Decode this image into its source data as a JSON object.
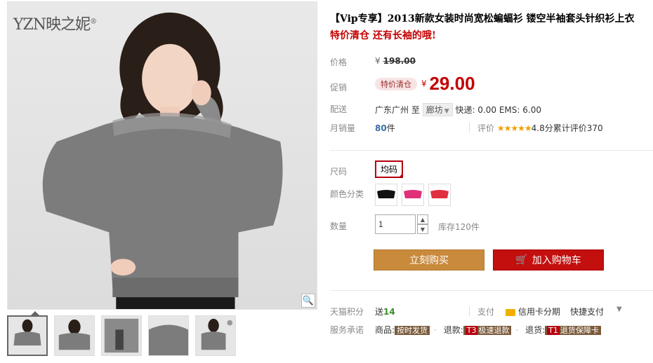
{
  "brand": {
    "logo_text": "YZN",
    "logo_cn": "映之妮",
    "reg": "®"
  },
  "product": {
    "title": "【Vip专享】2013新款女装时尚宽松蝙蝠衫 镂空半袖套头针织衫上衣",
    "subtitle": "特价清仓 还有长袖的哦!"
  },
  "price": {
    "label": "价格",
    "currency": "¥",
    "original": "198.00"
  },
  "promo": {
    "label": "促销",
    "tag": "特价清仓",
    "currency": "¥",
    "price": "29.00"
  },
  "shipping": {
    "label": "配送",
    "from": "广东广州",
    "to_word": "至",
    "destination": "廊坊",
    "info": "快递: 0.00 EMS: 6.00"
  },
  "sales": {
    "label": "月销量",
    "count": "80",
    "unit": "件",
    "review_label": "评价",
    "stars": "★★★★★",
    "score": "4.8分",
    "review_text": "累计评价370"
  },
  "size": {
    "label": "尺码",
    "option": "均码"
  },
  "color": {
    "label": "颜色分类",
    "options": [
      "black",
      "pink",
      "red"
    ]
  },
  "quantity": {
    "label": "数量",
    "value": "1",
    "stock": "库存120件"
  },
  "buttons": {
    "buy_now": "立刻购买",
    "add_cart": "加入购物车"
  },
  "points": {
    "label": "天猫积分",
    "give": "送",
    "amount": "14",
    "pay_label": "支付",
    "credit": "信用卡分期",
    "quick_pay": "快捷支付"
  },
  "service": {
    "label": "服务承诺",
    "goods_label": "商品:",
    "goods_tag": "按时发货",
    "refund_label": "退款:",
    "refund_t": "T3",
    "refund_tag": "极速退款",
    "return_label": "退货:",
    "return_t": "T1",
    "return_tag": "退货保障卡"
  },
  "colors": {
    "accent_red": "#c40000",
    "buy_btn": "#c98a3c",
    "cart_btn": "#c40f0f"
  }
}
